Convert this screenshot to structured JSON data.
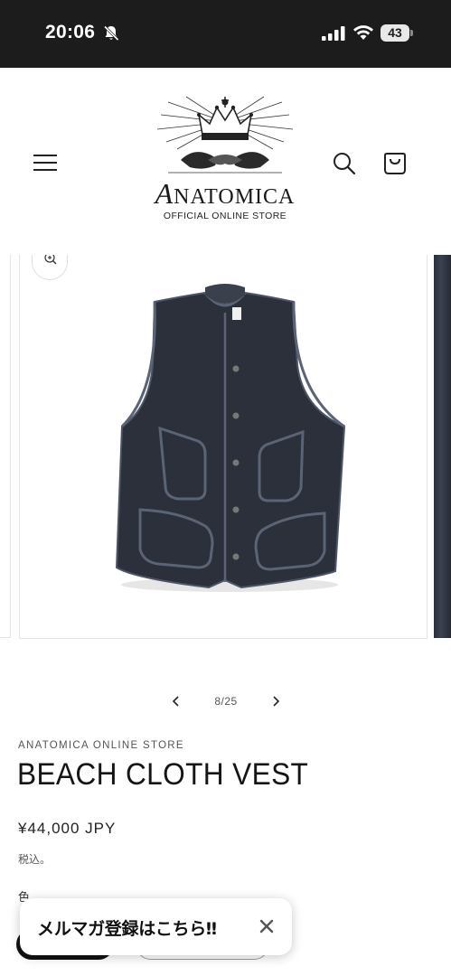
{
  "status_bar": {
    "time": "20:06",
    "battery": "43",
    "icons": [
      "bell-slash-icon",
      "signal-icon",
      "wifi-icon",
      "battery-icon"
    ]
  },
  "header": {
    "logo_text": "ANATOMICA",
    "logo_initial": "A",
    "logo_rest": "NATOMICA",
    "logo_subtitle": "OFFICIAL ONLINE STORE",
    "icons": [
      "menu-icon",
      "search-icon",
      "cart-icon"
    ]
  },
  "gallery": {
    "current_slide": 8,
    "total_slides": 25,
    "counter": "8/25",
    "zoom_icon": "zoom-in-icon",
    "product_color": "#2b303b"
  },
  "product": {
    "vendor": "ANATOMICA ONLINE STORE",
    "title": "BEACH CLOTH VEST",
    "price": "¥44,000 JPY",
    "tax_note": "税込。",
    "color_label": "色"
  },
  "popup": {
    "text": "メルマガ登録はこちら‼",
    "close_icon": "close-icon"
  }
}
